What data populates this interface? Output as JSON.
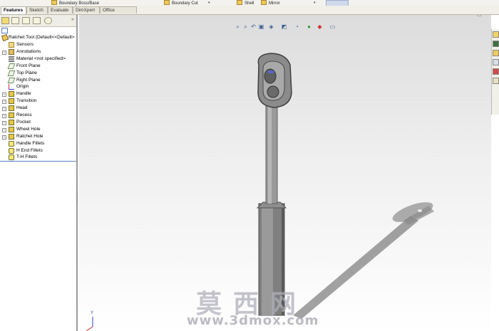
{
  "ribbon": {
    "items": [
      {
        "label": "Boundary Boss/Base"
      },
      {
        "label": "Boundary Cut"
      },
      {
        "label": "Shell"
      },
      {
        "label": "Mirror"
      }
    ]
  },
  "tabs": [
    {
      "label": "Features",
      "active": true
    },
    {
      "label": "Sketch",
      "active": false
    },
    {
      "label": "Evaluate",
      "active": false
    },
    {
      "label": "DimXpert",
      "active": false
    },
    {
      "label": "Office Products",
      "active": false
    }
  ],
  "feature_manager": {
    "more_glyph": "»",
    "root": "Ratchet Tool  (Default<<Default>",
    "items": [
      {
        "label": "Sensors",
        "icon": "sensors-icon"
      },
      {
        "label": "Annotations",
        "icon": "annotations-icon"
      },
      {
        "label": "Material <not specified>",
        "icon": "material-icon"
      },
      {
        "label": "Front Plane",
        "icon": "plane-icon"
      },
      {
        "label": "Top Plane",
        "icon": "plane-icon"
      },
      {
        "label": "Right Plane",
        "icon": "plane-icon"
      },
      {
        "label": "Origin",
        "icon": "origin-icon"
      },
      {
        "label": "Handle",
        "icon": "feature-icon"
      },
      {
        "label": "Transition",
        "icon": "feature-icon"
      },
      {
        "label": "Head",
        "icon": "feature-icon"
      },
      {
        "label": "Recess",
        "icon": "feature-icon"
      },
      {
        "label": "Pocket",
        "icon": "feature-icon"
      },
      {
        "label": "Wheel Hole",
        "icon": "feature-icon"
      },
      {
        "label": "Ratchet Hole",
        "icon": "feature-icon"
      },
      {
        "label": "Handle Fillets",
        "icon": "fillet-icon"
      },
      {
        "label": "H End Fillets",
        "icon": "fillet-icon"
      },
      {
        "label": "T-H Fillets",
        "icon": "fillet-icon"
      }
    ]
  },
  "watermark": {
    "chinese": "莫西网",
    "url": "www.3dmox.com"
  },
  "colors": {
    "accent": "#5b7dbf",
    "feature_icon": "#e8c64a",
    "viewport_top": "#dcdcdc",
    "model_gray": "#8a8a8a"
  }
}
